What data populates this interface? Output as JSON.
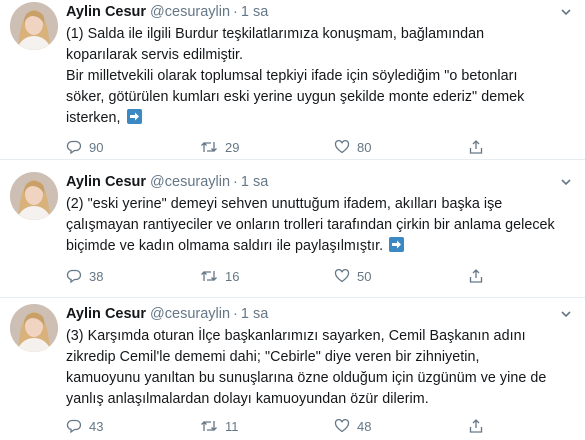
{
  "tweets": [
    {
      "name": "Aylin Cesur",
      "handle": "@cesuraylin",
      "separator": "·",
      "time": "1 sa",
      "lines": [
        "(1) Salda ile ilgili Burdur teşkilatlarımıza konuşmam, bağlamından",
        "koparılarak servis edilmiştir.",
        "Bir milletvekili olarak toplumsal tepkiyi ifade için söylediğim \"o betonları",
        "söker, götürülen kumları eski yerine uygun şekilde monte ederiz\" demek",
        "isterken,"
      ],
      "replies": "90",
      "retweets": "29",
      "likes": "80"
    },
    {
      "name": "Aylin Cesur",
      "handle": "@cesuraylin",
      "separator": "·",
      "time": "1 sa",
      "lines": [
        "(2) \"eski yerine\" demeyi sehven unuttuğum ifadem, akılları başka işe",
        "çalışmayan rantiyeciler ve onların trolleri tarafından çirkin bir anlama gelecek",
        "biçimde ve kadın olmama saldırı ile paylaşılmıştır."
      ],
      "replies": "38",
      "retweets": "16",
      "likes": "50"
    },
    {
      "name": "Aylin Cesur",
      "handle": "@cesuraylin",
      "separator": "·",
      "time": "1 sa",
      "lines": [
        "(3) Karşımda oturan İlçe başkanlarımızı sayarken, Cemil Başkanın adını",
        "zikredip Cemil'le dememi dahi; \"Cebirle\" diye veren bir zihniyetin,",
        "kamuoyunu yanıltan bu sunuşlarına özne olduğum için üzgünüm ve yine de",
        "yanlış anlaşılmalardan dolayı kamuoyundan özür dilerim."
      ],
      "replies": "43",
      "retweets": "11",
      "likes": "48"
    }
  ],
  "icons": {
    "reply": "reply-icon",
    "retweet": "retweet-icon",
    "like": "heart-icon",
    "share": "share-icon",
    "caret": "chevron-down-icon",
    "continue": "arrow-right-icon"
  },
  "colors": {
    "text": "#14171a",
    "muted": "#657786",
    "divider": "#e6ecf0",
    "arrow_box": "#3b88c3"
  }
}
